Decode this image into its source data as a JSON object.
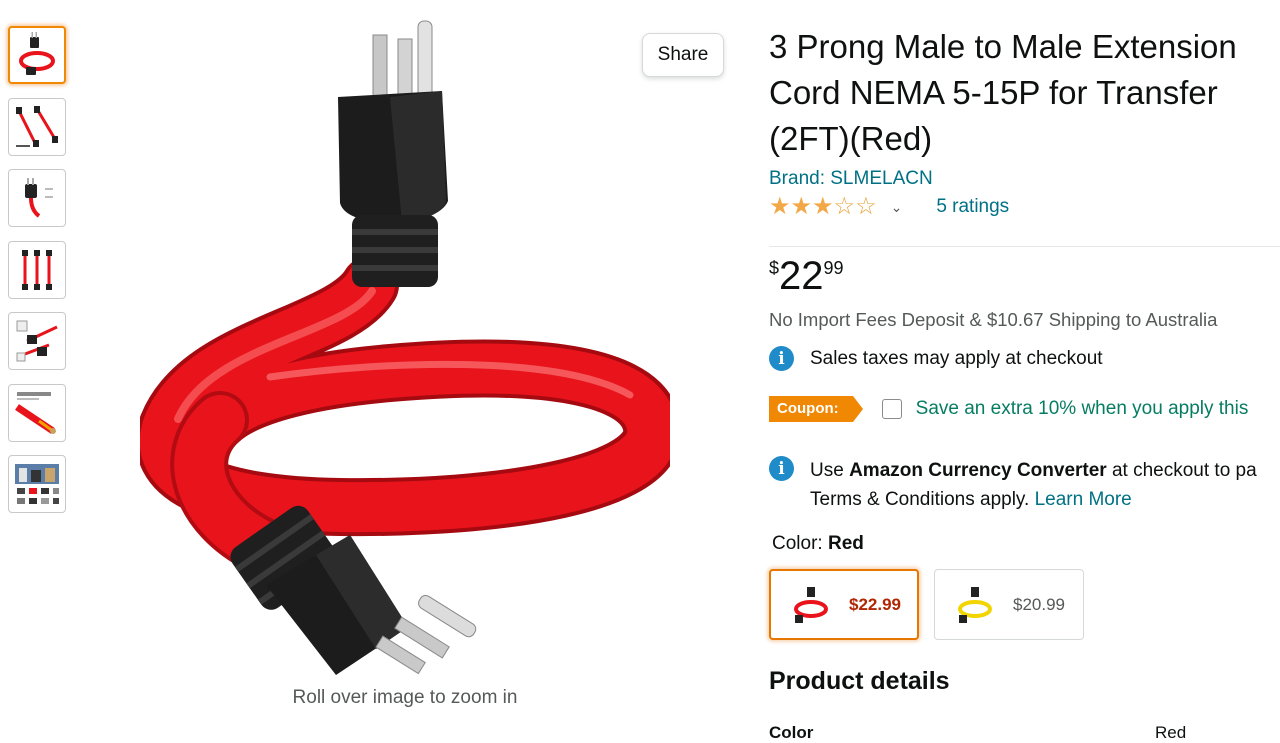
{
  "gallery": {
    "thumbnails": [
      {
        "name": "thumbnail-1",
        "active": true
      },
      {
        "name": "thumbnail-2",
        "active": false
      },
      {
        "name": "thumbnail-3",
        "active": false
      },
      {
        "name": "thumbnail-4",
        "active": false
      },
      {
        "name": "thumbnail-5",
        "active": false
      },
      {
        "name": "thumbnail-6",
        "active": false
      },
      {
        "name": "thumbnail-7",
        "active": false
      }
    ],
    "share_label": "Share",
    "zoom_hint": "Roll over image to zoom in"
  },
  "product": {
    "title": "3 Prong Male to Male Extension Cord NEMA 5-15P for Transfer (2FT)(Red)",
    "brand": "Brand: SLMELACN",
    "rating": 3,
    "rating_max": 5,
    "ratings_count": "5 ratings"
  },
  "price": {
    "symbol": "$",
    "whole": "22",
    "fraction": "99"
  },
  "shipping": {
    "import_note": "No Import Fees Deposit & $10.67 Shipping to Australia",
    "tax_note": "Sales taxes may apply at checkout"
  },
  "coupon": {
    "badge": "Coupon:",
    "text": "Save an extra 10% when you apply this"
  },
  "currency": {
    "use": "Use ",
    "converter": "Amazon Currency Converter",
    "after": " at checkout to pa",
    "terms": "Terms & Conditions apply. ",
    "learn_more": "Learn More"
  },
  "color": {
    "label": "Color: ",
    "selected": "Red",
    "options": [
      {
        "name": "Red",
        "price": "$22.99",
        "hex": "#e8131b"
      },
      {
        "name": "Yellow",
        "price": "$20.99",
        "hex": "#f2d500"
      }
    ]
  },
  "details": {
    "heading": "Product details",
    "rows": [
      {
        "key": "Color",
        "value": "Red"
      }
    ]
  },
  "colors": {
    "link": "#007185",
    "star": "#f3a847",
    "coupon": "#f08804",
    "coupon_text": "#067d62",
    "sale_price": "#b12704",
    "cord": "#e8131b"
  }
}
